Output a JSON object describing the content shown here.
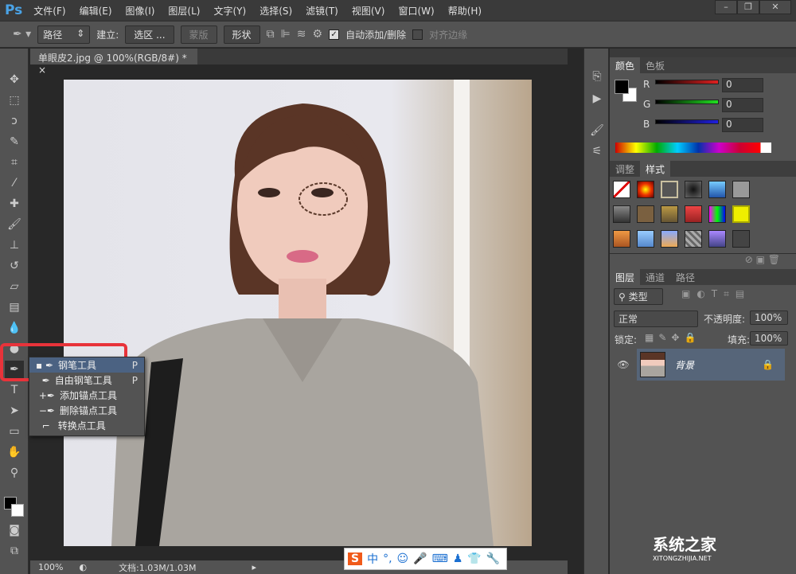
{
  "app": {
    "logo": "Ps"
  },
  "menu": [
    "文件(F)",
    "编辑(E)",
    "图像(I)",
    "图层(L)",
    "文字(Y)",
    "选择(S)",
    "滤镜(T)",
    "视图(V)",
    "窗口(W)",
    "帮助(H)"
  ],
  "options": {
    "mode": "路径",
    "create_label": "建立:",
    "selection_btn": "选区 ...",
    "mask_btn": "蒙版",
    "shape_btn": "形状",
    "auto_add_delete": "自动添加/删除",
    "align_edges": "对齐边缘"
  },
  "document": {
    "tab_title": "单眼皮2.jpg @ 100%(RGB/8#) *",
    "close": "×",
    "zoom": "100%",
    "doc_size": "文档:1.03M/1.03M"
  },
  "flyout": {
    "items": [
      {
        "label": "钢笔工具",
        "key": "P"
      },
      {
        "label": "自由钢笔工具",
        "key": "P"
      },
      {
        "label": "添加锚点工具",
        "key": ""
      },
      {
        "label": "删除锚点工具",
        "key": ""
      },
      {
        "label": "转换点工具",
        "key": ""
      }
    ]
  },
  "color_panel": {
    "tabs": [
      "颜色",
      "色板"
    ],
    "channels": [
      {
        "name": "R",
        "value": "0",
        "color": "#e02020"
      },
      {
        "name": "G",
        "value": "0",
        "color": "#20e020"
      },
      {
        "name": "B",
        "value": "0",
        "color": "#2020e0"
      }
    ]
  },
  "styles_panel": {
    "tabs": [
      "调整",
      "样式"
    ]
  },
  "layers_panel": {
    "tabs": [
      "图层",
      "通道",
      "路径"
    ],
    "filter": "类型",
    "blend": "正常",
    "opacity_label": "不透明度:",
    "opacity": "100%",
    "lock_label": "锁定:",
    "fill_label": "填充:",
    "fill": "100%",
    "layers": [
      {
        "name": "背景"
      }
    ]
  },
  "ime": {
    "label": "中"
  },
  "watermark": {
    "title": "系统之家",
    "url": "XITONGZHIJIA.NET"
  }
}
